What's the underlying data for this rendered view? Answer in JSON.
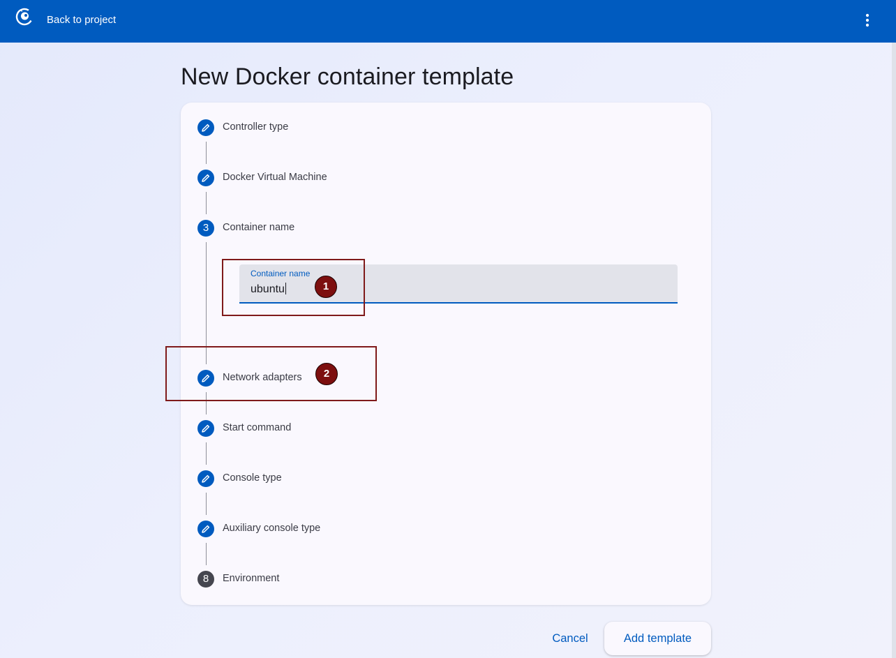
{
  "header": {
    "back_label": "Back to project",
    "logo_icon": "gns3-logo-icon",
    "menu_icon": "more-vert-icon",
    "color": "#005bbf"
  },
  "page": {
    "title": "New Docker container template"
  },
  "stepper": {
    "steps": [
      {
        "label": "Controller type",
        "marker": "",
        "icon": "edit-icon"
      },
      {
        "label": "Docker Virtual Machine",
        "marker": "",
        "icon": "edit-icon"
      },
      {
        "label": "Container name",
        "marker": "3",
        "state": "active"
      },
      {
        "label": "Network adapters",
        "marker": "",
        "icon": "edit-icon"
      },
      {
        "label": "Start command",
        "marker": "",
        "icon": "edit-icon"
      },
      {
        "label": "Console type",
        "marker": "",
        "icon": "edit-icon"
      },
      {
        "label": "Auxiliary console type",
        "marker": "",
        "icon": "edit-icon"
      },
      {
        "label": "Environment",
        "marker": "8",
        "state": "pending"
      }
    ]
  },
  "container_name_field": {
    "label": "Container name",
    "value": "ubuntu"
  },
  "annotations": [
    {
      "number": "1",
      "color": "#7d0f0f"
    },
    {
      "number": "2",
      "color": "#7d0f0f"
    }
  ],
  "actions": {
    "cancel_label": "Cancel",
    "add_label": "Add template"
  }
}
